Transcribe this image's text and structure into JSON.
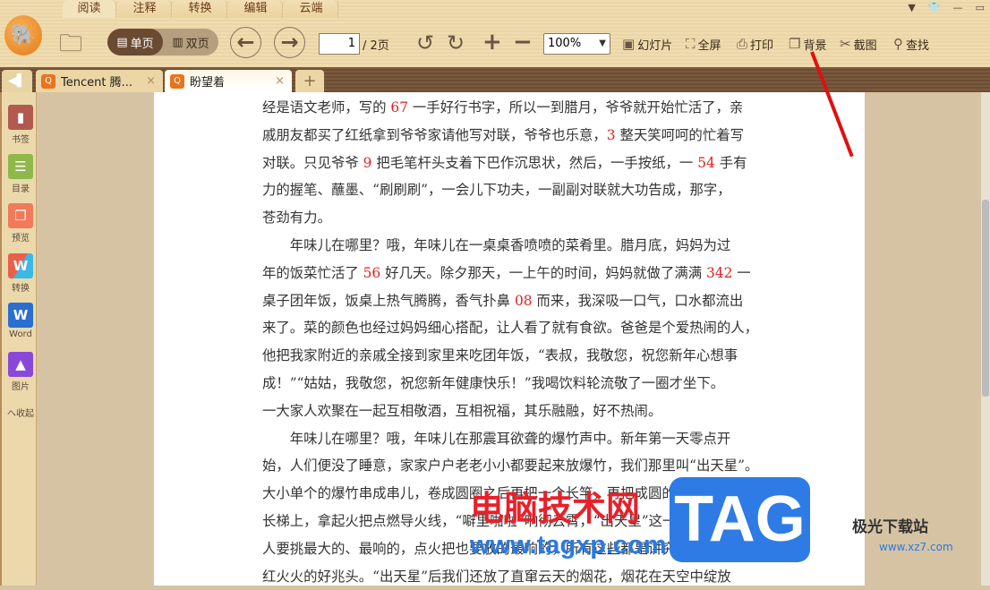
{
  "menu_tabs": [
    "阅读",
    "注释",
    "转换",
    "编辑",
    "云端"
  ],
  "toolbar": {
    "single": "单页",
    "double": "双页",
    "page_value": "1",
    "page_total": "/ 2页",
    "zoom": "100%",
    "slideshow": "幻灯片",
    "fullscreen": "全屏",
    "print": "打印",
    "background": "背景",
    "screenshot": "截图",
    "find": "查找"
  },
  "tabs": [
    {
      "label": "Tencent 腾..."
    },
    {
      "label": "盼望着"
    }
  ],
  "sidebar": [
    {
      "label": "书签",
      "color": "#b35a50"
    },
    {
      "label": "目录",
      "color": "#8fb84a"
    },
    {
      "label": "预览",
      "color": "#f07a5a"
    },
    {
      "label": "转换",
      "color": "#e8604a"
    },
    {
      "label": "Word",
      "color": "#2a6fd0"
    },
    {
      "label": "图片",
      "color": "#8a48d8"
    }
  ],
  "collapse": "へ收起",
  "lines": [
    [
      "经是语文老师，写的 ",
      "67",
      " 一手好行书字，所以一到腊月，爷爷就开始忙活了，亲"
    ],
    [
      "戚朋友都买了红纸拿到爷爷家请他写对联，爷爷也乐意，",
      "3",
      " 整天笑呵呵的忙着写"
    ],
    [
      "对联。只见爷爷 ",
      "9",
      " 把毛笔杆头支着下巴作沉思状，然后，一手按纸，一 ",
      "54",
      " 手有"
    ],
    [
      "力的握笔、蘸墨、“刷刷刷”，一会儿下功夫，一副副对联就大功告成，那字，"
    ],
    [
      "苍劲有力。"
    ],
    [
      "　　年味儿在哪里？哦，年味儿在一桌桌香喷喷的菜肴里。腊月底，妈妈为过"
    ],
    [
      "年的饭菜忙活了 ",
      "56",
      " 好几天。除夕那天，一上午的时间，妈妈就做了满满 ",
      "342",
      " 一"
    ],
    [
      "桌子团年饭，饭桌上热气腾腾，香气扑鼻 ",
      "08",
      " 而来，我深吸一口气，口水都流出"
    ],
    [
      "来了。菜的颜色也经过妈妈细心搭配，让人看了就有食欲。爸爸是个爱热闹的人，"
    ],
    [
      "他把我家附近的亲戚全接到家里来吃团年饭，“表叔，我敬您，祝您新年心想事"
    ],
    [
      "成！”“姑姑，我敬您，祝您新年健康快乐！”我喝饮料轮流敬了一圈才坐下。"
    ],
    [
      "一大家人欢聚在一起互相敬酒，互相祝福，其乐融融，好不热闹。"
    ],
    [
      "　　年味儿在哪里？哦，年味儿在那震耳欲聋的爆竹声中。新年第一天零点开"
    ],
    [
      "始，人们便没了睡意，家家户户老老小小都要起来放爆竹，我们那里叫“出天星”。"
    ],
    [
      "大小单个的爆竹串成串儿，卷成圆圈之后再把一个长竿，再把成圆的爆竹挂在"
    ],
    [
      "长梯上，拿起火把点燃导火线，“噼里啪啦”响彻云霄，“出天星”这一推主"
    ],
    [
      "人要挑最大的、最响的，点火把也要放的最响的，所有这些都是讲究的是新年红"
    ],
    [
      "红火火的好兆头。“出天星”后我们还放了直窜云天的烟花，烟花在天空中绽放"
    ]
  ],
  "watermarks": {
    "site_cn": "电脑技术网",
    "site_url": "www.tagxp.com",
    "tag": "TAG",
    "brand": "极光下载站",
    "brand_url": "www.xz7.com"
  }
}
